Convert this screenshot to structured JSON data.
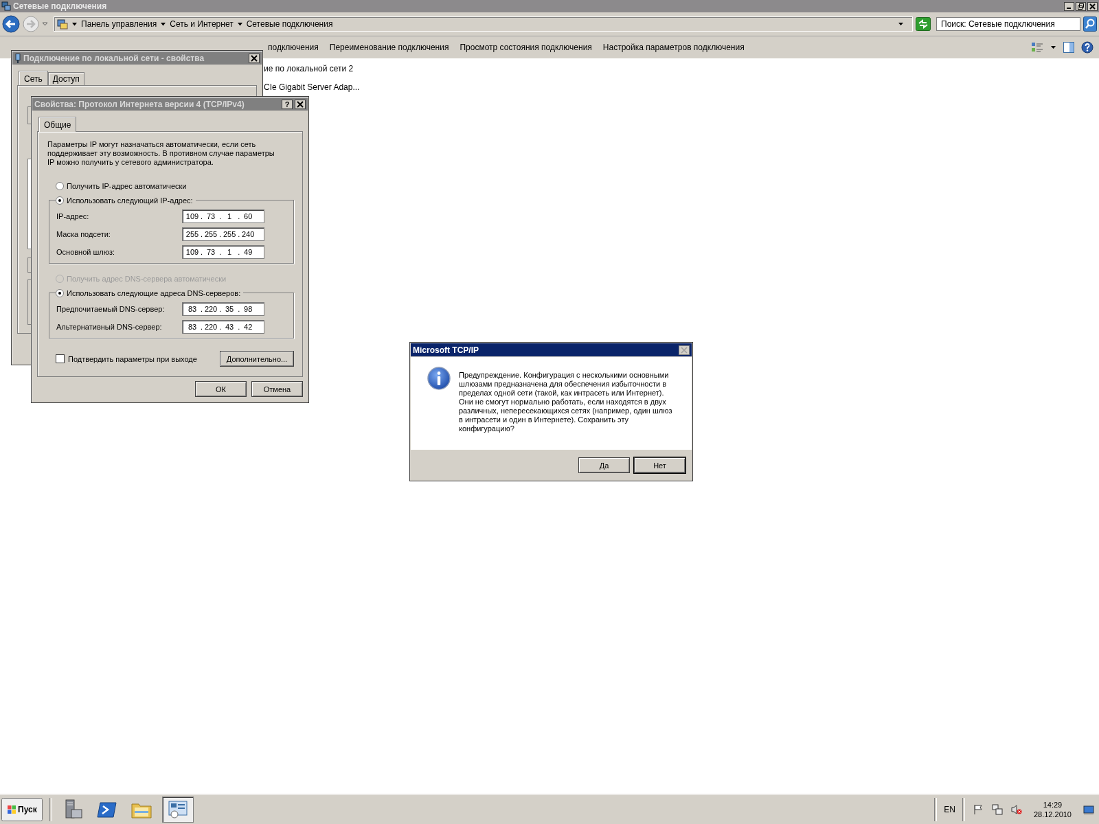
{
  "window": {
    "title": "Сетевые подключения",
    "breadcrumbs": [
      "Панель управления",
      "Сеть и Интернет",
      "Сетевые подключения"
    ],
    "search": {
      "placeholder": "Поиск: Сетевые подключения"
    },
    "toolbar": [
      "подключения",
      "Переименование подключения",
      "Просмотр состояния подключения",
      "Настройка параметров подключения"
    ],
    "content": [
      "ие по локальной сети 2",
      "CIe Gigabit Server Adap..."
    ]
  },
  "lan_dialog": {
    "title": "Подключение по локальной сети - свойства",
    "tabs": [
      {
        "label": "Сеть",
        "selected": true
      },
      {
        "label": "Доступ",
        "selected": false
      }
    ]
  },
  "ipv4_dialog": {
    "title": "Свойства: Протокол Интернета версии 4 (TCP/IPv4)",
    "help": "?",
    "tabs": [
      {
        "label": "Общие",
        "selected": true
      }
    ],
    "description": "Параметры IP могут назначаться автоматически, если сеть поддерживает эту возможность. В противном случае параметры IP можно получить у сетевого администратора.",
    "separator": ".",
    "ip_mode": [
      {
        "label": "Получить IP-адрес автоматически",
        "selected": false,
        "disabled": false
      },
      {
        "label": "Использовать следующий IP-адрес:",
        "selected": true,
        "disabled": false
      }
    ],
    "ip_fields": [
      {
        "label": "IP-адрес:",
        "octets": [
          "109",
          "73",
          "1",
          "60"
        ]
      },
      {
        "label": "Маска подсети:",
        "octets": [
          "255",
          "255",
          "255",
          "240"
        ]
      },
      {
        "label": "Основной шлюз:",
        "octets": [
          "109",
          "73",
          "1",
          "49"
        ]
      }
    ],
    "dns_mode": [
      {
        "label": "Получить адрес DNS-сервера автоматически",
        "selected": false,
        "disabled": true
      },
      {
        "label": "Использовать следующие адреса DNS-серверов:",
        "selected": true,
        "disabled": false
      }
    ],
    "dns_fields": [
      {
        "label": "Предпочитаемый DNS-сервер:",
        "octets": [
          "83",
          "220",
          "35",
          "98"
        ]
      },
      {
        "label": "Альтернативный DNS-сервер:",
        "octets": [
          "83",
          "220",
          "43",
          "42"
        ]
      }
    ],
    "confirm": {
      "label": "Подтвердить параметры при выходе",
      "checked": false
    },
    "advanced_button": "Дополнительно...",
    "buttons": [
      "ОК",
      "Отмена"
    ]
  },
  "message_box": {
    "title": "Microsoft TCP/IP",
    "text": "Предупреждение. Конфигурация с несколькими основными шлюзами предназначена для обеспечения избыточности в пределах одной сети (такой, как интрасеть или Интернет). Они не смогут нормально работать, если находятся в двух различных, непересекающихся сетях (например, один шлюз в интрасети и один в Интернете). Сохранить эту конфигурацию?",
    "buttons": [
      {
        "label": "Да",
        "selected": false
      },
      {
        "label": "Нет",
        "selected": true
      }
    ]
  },
  "taskbar": {
    "start": "Пуск",
    "language": "EN",
    "time": "14:29",
    "date": "28.12.2010"
  }
}
